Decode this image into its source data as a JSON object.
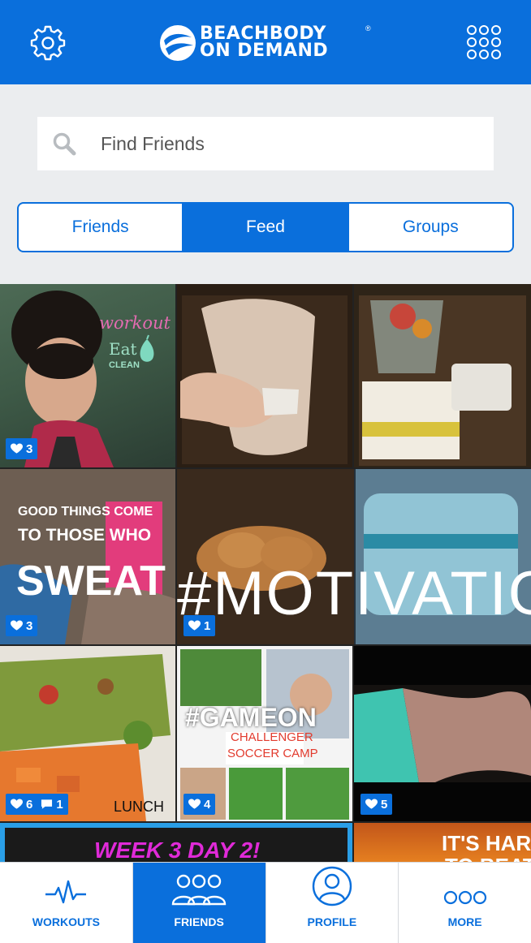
{
  "header": {
    "logo_line1": "BEACHBODY",
    "logo_line2": "ON DEMAND",
    "logo_reg": "®",
    "left_icon": "gear-icon",
    "right_icon": "grid-menu-icon"
  },
  "search": {
    "placeholder": "Find Friends",
    "icon": "search-icon"
  },
  "tabs": [
    {
      "label": "Friends",
      "active": false
    },
    {
      "label": "Feed",
      "active": true
    },
    {
      "label": "Groups",
      "active": false
    }
  ],
  "feed": {
    "tiles": [
      {
        "caption": "workout",
        "caption2": "Eat",
        "caption3": "CLEAN",
        "likes": "3"
      },
      {
        "likes": ""
      },
      {
        "likes": ""
      },
      {
        "caption": "GOOD THINGS COME",
        "caption2": "TO THOSE WHO",
        "caption3": "SWEAT",
        "likes": "3"
      },
      {
        "caption": "#MOTIVATION",
        "likes": "1"
      },
      {
        "caption": "LUNCH",
        "likes": "6",
        "comments": "1"
      },
      {
        "caption": "#GAMEON",
        "caption2": "CHALLENGER",
        "caption3": "SOCCER CAMP",
        "likes": "4"
      },
      {
        "likes": "5"
      },
      {
        "caption": "WEEK 3 DAY 2!"
      },
      {
        "caption": "IT'S HARD",
        "caption2": "TO BEAT"
      }
    ]
  },
  "nav": [
    {
      "label": "WORKOUTS",
      "icon": "pulse-icon",
      "active": false
    },
    {
      "label": "FRIENDS",
      "icon": "friends-icon",
      "active": true
    },
    {
      "label": "PROFILE",
      "icon": "profile-icon",
      "active": false
    },
    {
      "label": "MORE",
      "icon": "more-icon",
      "active": false
    }
  ],
  "colors": {
    "brand": "#0a6fdc",
    "background": "#ebedef"
  }
}
